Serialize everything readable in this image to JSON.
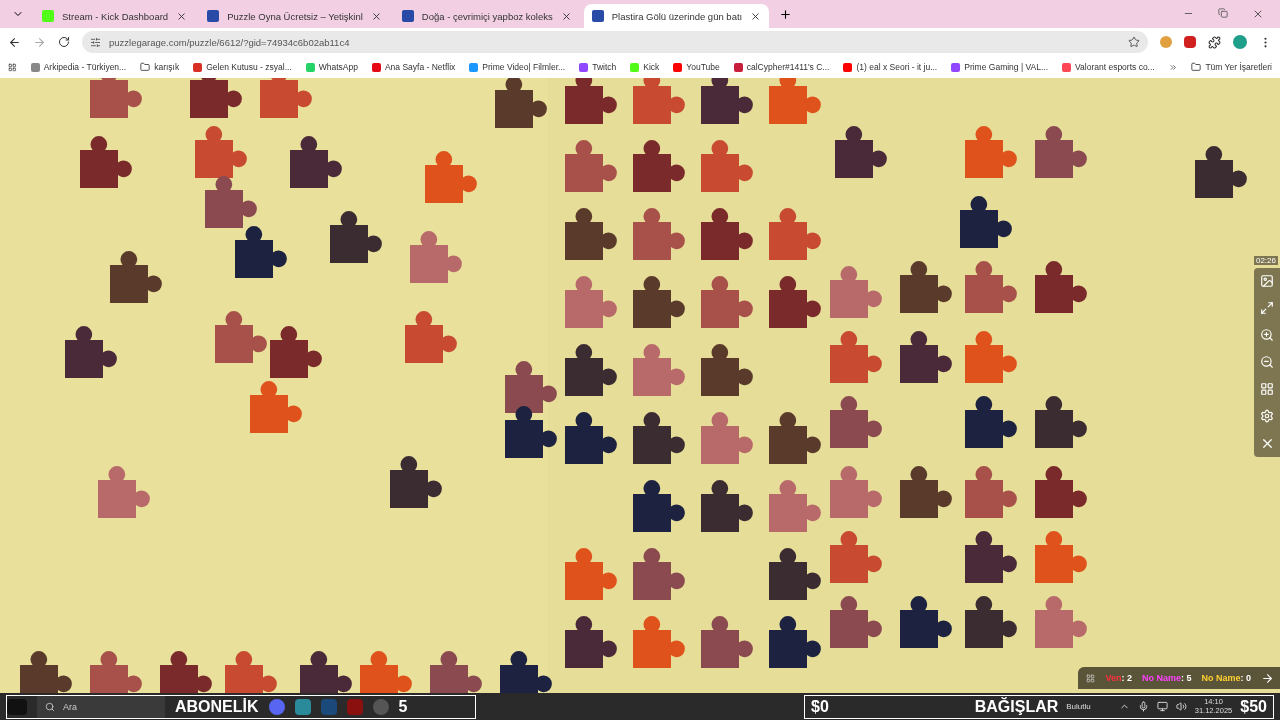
{
  "tabs": [
    {
      "title": "Stream - Kick Dashboard",
      "selected": false
    },
    {
      "title": "Puzzle Oyna Ücretsiz – Yetişkinl",
      "selected": false
    },
    {
      "title": "Doğa - çevrimiçi yapboz koleks",
      "selected": false
    },
    {
      "title": "Plastira Gölü üzerinde gün batı",
      "selected": true
    }
  ],
  "address": {
    "url": "puzzlegarage.com/puzzle/6612/?gid=74934c6b02ab11c4"
  },
  "bookmarks": [
    "Arkipedia - Türkiyen...",
    "karışık",
    "Gelen Kutusu - zsyal...",
    "WhatsApp",
    "Ana Sayfa - Netflix",
    "Prime Video| Filmler...",
    "Twitch",
    "Kick",
    "YouTube",
    "calCypher#1411's C...",
    "(1) eal x Seori - it ju...",
    "Prime Gaming | VAL...",
    "Valorant esports co..."
  ],
  "all_bookmarks": "Tüm Yer İşaretleri",
  "puzzle": {
    "timer": "02:26",
    "players": [
      {
        "name": "Ven",
        "score": ": 2",
        "color": "#ff3040"
      },
      {
        "name": "No Name",
        "score": ": 5",
        "color": "#ff40ff"
      },
      {
        "name": "No Name",
        "score": ": 0",
        "color": "#ffd030"
      }
    ]
  },
  "taskbar": {
    "search_placeholder": "Ara",
    "subscription": "ABONELİK",
    "badge": "5",
    "donation_current": "$0",
    "donations": "BAĞIŞLAR",
    "donation_goal": "$50",
    "weather": "Bulutlu",
    "time": "14:10",
    "date": "31.12.2025"
  }
}
